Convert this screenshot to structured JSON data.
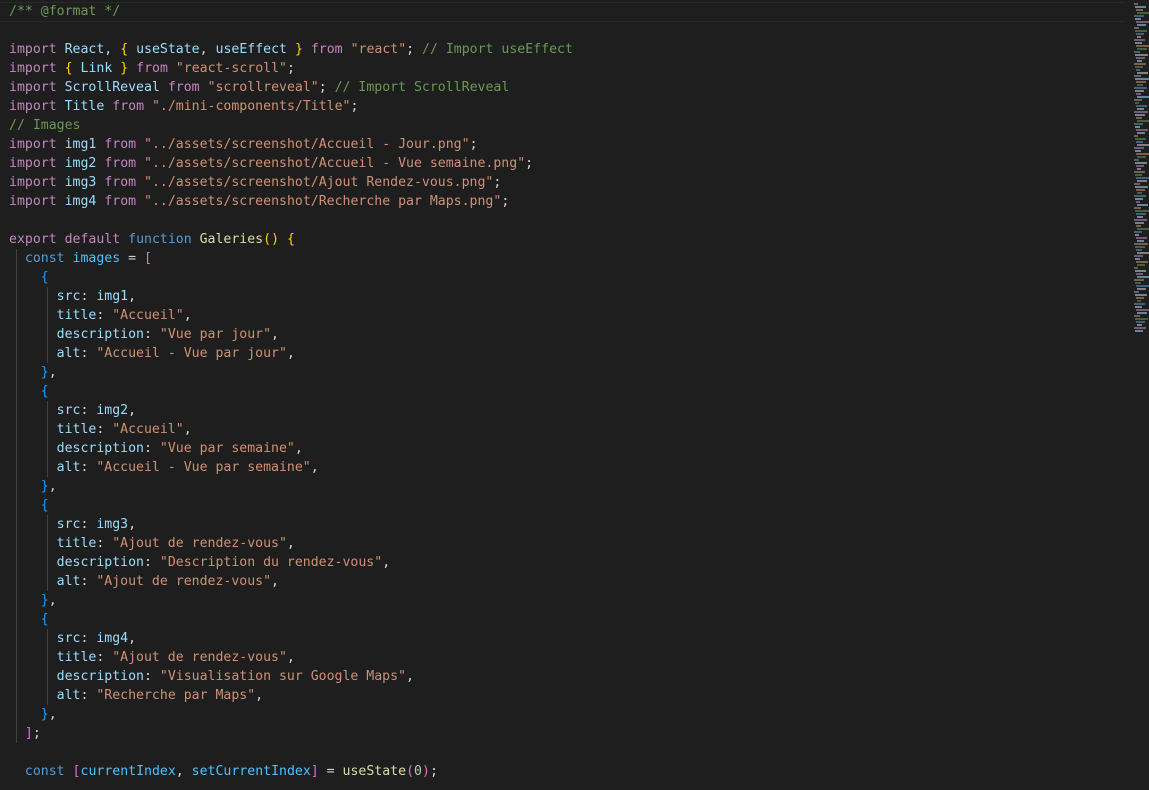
{
  "editor": {
    "language": "javascript",
    "lines": [
      [
        [
          "cm",
          "/** @format */"
        ]
      ],
      [],
      [
        [
          "kw",
          "import"
        ],
        [
          "p",
          " "
        ],
        [
          "vr",
          "React"
        ],
        [
          "p",
          ", "
        ],
        [
          "b1",
          "{"
        ],
        [
          "p",
          " "
        ],
        [
          "vr",
          "useState"
        ],
        [
          "p",
          ", "
        ],
        [
          "vr",
          "useEffect"
        ],
        [
          "p",
          " "
        ],
        [
          "b1",
          "}"
        ],
        [
          "p",
          " "
        ],
        [
          "kw",
          "from"
        ],
        [
          "p",
          " "
        ],
        [
          "st",
          "\"react\""
        ],
        [
          "p",
          "; "
        ],
        [
          "cm",
          "// Import useEffect"
        ]
      ],
      [
        [
          "kw",
          "import"
        ],
        [
          "p",
          " "
        ],
        [
          "b1",
          "{"
        ],
        [
          "p",
          " "
        ],
        [
          "vr",
          "Link"
        ],
        [
          "p",
          " "
        ],
        [
          "b1",
          "}"
        ],
        [
          "p",
          " "
        ],
        [
          "kw",
          "from"
        ],
        [
          "p",
          " "
        ],
        [
          "st",
          "\"react-scroll\""
        ],
        [
          "p",
          ";"
        ]
      ],
      [
        [
          "kw",
          "import"
        ],
        [
          "p",
          " "
        ],
        [
          "vr",
          "ScrollReveal"
        ],
        [
          "p",
          " "
        ],
        [
          "kw",
          "from"
        ],
        [
          "p",
          " "
        ],
        [
          "st",
          "\"scrollreveal\""
        ],
        [
          "p",
          "; "
        ],
        [
          "cm",
          "// Import ScrollReveal"
        ]
      ],
      [
        [
          "kw",
          "import"
        ],
        [
          "p",
          " "
        ],
        [
          "vr",
          "Title"
        ],
        [
          "p",
          " "
        ],
        [
          "kw",
          "from"
        ],
        [
          "p",
          " "
        ],
        [
          "st",
          "\"./mini-components/Title\""
        ],
        [
          "p",
          ";"
        ]
      ],
      [
        [
          "cm",
          "// Images"
        ]
      ],
      [
        [
          "kw",
          "import"
        ],
        [
          "p",
          " "
        ],
        [
          "vr",
          "img1"
        ],
        [
          "p",
          " "
        ],
        [
          "kw",
          "from"
        ],
        [
          "p",
          " "
        ],
        [
          "st",
          "\"../assets/screenshot/Accueil - Jour.png\""
        ],
        [
          "p",
          ";"
        ]
      ],
      [
        [
          "kw",
          "import"
        ],
        [
          "p",
          " "
        ],
        [
          "vr",
          "img2"
        ],
        [
          "p",
          " "
        ],
        [
          "kw",
          "from"
        ],
        [
          "p",
          " "
        ],
        [
          "st",
          "\"../assets/screenshot/Accueil - Vue semaine.png\""
        ],
        [
          "p",
          ";"
        ]
      ],
      [
        [
          "kw",
          "import"
        ],
        [
          "p",
          " "
        ],
        [
          "vr",
          "img3"
        ],
        [
          "p",
          " "
        ],
        [
          "kw",
          "from"
        ],
        [
          "p",
          " "
        ],
        [
          "st",
          "\"../assets/screenshot/Ajout Rendez-vous.png\""
        ],
        [
          "p",
          ";"
        ]
      ],
      [
        [
          "kw",
          "import"
        ],
        [
          "p",
          " "
        ],
        [
          "vr",
          "img4"
        ],
        [
          "p",
          " "
        ],
        [
          "kw",
          "from"
        ],
        [
          "p",
          " "
        ],
        [
          "st",
          "\"../assets/screenshot/Recherche par Maps.png\""
        ],
        [
          "p",
          ";"
        ]
      ],
      [],
      [
        [
          "kw",
          "export"
        ],
        [
          "p",
          " "
        ],
        [
          "kw",
          "default"
        ],
        [
          "p",
          " "
        ],
        [
          "sk",
          "function"
        ],
        [
          "p",
          " "
        ],
        [
          "fn",
          "Galeries"
        ],
        [
          "b1",
          "()"
        ],
        [
          "p",
          " "
        ],
        [
          "b1",
          "{"
        ]
      ],
      [
        [
          "p",
          "  "
        ],
        [
          "sk",
          "const"
        ],
        [
          "p",
          " "
        ],
        [
          "cn",
          "images"
        ],
        [
          "p",
          " = "
        ],
        [
          "b2",
          "["
        ]
      ],
      [
        [
          "p",
          "    "
        ],
        [
          "b3",
          "{"
        ]
      ],
      [
        [
          "p",
          "      "
        ],
        [
          "vr",
          "src"
        ],
        [
          "p",
          ": "
        ],
        [
          "vr",
          "img1"
        ],
        [
          "p",
          ","
        ]
      ],
      [
        [
          "p",
          "      "
        ],
        [
          "vr",
          "title"
        ],
        [
          "p",
          ": "
        ],
        [
          "st",
          "\"Accueil\""
        ],
        [
          "p",
          ","
        ]
      ],
      [
        [
          "p",
          "      "
        ],
        [
          "vr",
          "description"
        ],
        [
          "p",
          ": "
        ],
        [
          "st",
          "\"Vue par jour\""
        ],
        [
          "p",
          ","
        ]
      ],
      [
        [
          "p",
          "      "
        ],
        [
          "vr",
          "alt"
        ],
        [
          "p",
          ": "
        ],
        [
          "st",
          "\"Accueil - Vue par jour\""
        ],
        [
          "p",
          ","
        ]
      ],
      [
        [
          "p",
          "    "
        ],
        [
          "b3",
          "}"
        ],
        [
          "p",
          ","
        ]
      ],
      [
        [
          "p",
          "    "
        ],
        [
          "b3",
          "{"
        ]
      ],
      [
        [
          "p",
          "      "
        ],
        [
          "vr",
          "src"
        ],
        [
          "p",
          ": "
        ],
        [
          "vr",
          "img2"
        ],
        [
          "p",
          ","
        ]
      ],
      [
        [
          "p",
          "      "
        ],
        [
          "vr",
          "title"
        ],
        [
          "p",
          ": "
        ],
        [
          "st",
          "\"Accueil\""
        ],
        [
          "p",
          ","
        ]
      ],
      [
        [
          "p",
          "      "
        ],
        [
          "vr",
          "description"
        ],
        [
          "p",
          ": "
        ],
        [
          "st",
          "\"Vue par semaine\""
        ],
        [
          "p",
          ","
        ]
      ],
      [
        [
          "p",
          "      "
        ],
        [
          "vr",
          "alt"
        ],
        [
          "p",
          ": "
        ],
        [
          "st",
          "\"Accueil - Vue par semaine\""
        ],
        [
          "p",
          ","
        ]
      ],
      [
        [
          "p",
          "    "
        ],
        [
          "b3",
          "}"
        ],
        [
          "p",
          ","
        ]
      ],
      [
        [
          "p",
          "    "
        ],
        [
          "b3",
          "{"
        ]
      ],
      [
        [
          "p",
          "      "
        ],
        [
          "vr",
          "src"
        ],
        [
          "p",
          ": "
        ],
        [
          "vr",
          "img3"
        ],
        [
          "p",
          ","
        ]
      ],
      [
        [
          "p",
          "      "
        ],
        [
          "vr",
          "title"
        ],
        [
          "p",
          ": "
        ],
        [
          "st",
          "\"Ajout de rendez-vous\""
        ],
        [
          "p",
          ","
        ]
      ],
      [
        [
          "p",
          "      "
        ],
        [
          "vr",
          "description"
        ],
        [
          "p",
          ": "
        ],
        [
          "st",
          "\"Description du rendez-vous\""
        ],
        [
          "p",
          ","
        ]
      ],
      [
        [
          "p",
          "      "
        ],
        [
          "vr",
          "alt"
        ],
        [
          "p",
          ": "
        ],
        [
          "st",
          "\"Ajout de rendez-vous\""
        ],
        [
          "p",
          ","
        ]
      ],
      [
        [
          "p",
          "    "
        ],
        [
          "b3",
          "}"
        ],
        [
          "p",
          ","
        ]
      ],
      [
        [
          "p",
          "    "
        ],
        [
          "b3",
          "{"
        ]
      ],
      [
        [
          "p",
          "      "
        ],
        [
          "vr",
          "src"
        ],
        [
          "p",
          ": "
        ],
        [
          "vr",
          "img4"
        ],
        [
          "p",
          ","
        ]
      ],
      [
        [
          "p",
          "      "
        ],
        [
          "vr",
          "title"
        ],
        [
          "p",
          ": "
        ],
        [
          "st",
          "\"Ajout de rendez-vous\""
        ],
        [
          "p",
          ","
        ]
      ],
      [
        [
          "p",
          "      "
        ],
        [
          "vr",
          "description"
        ],
        [
          "p",
          ": "
        ],
        [
          "st",
          "\"Visualisation sur Google Maps\""
        ],
        [
          "p",
          ","
        ]
      ],
      [
        [
          "p",
          "      "
        ],
        [
          "vr",
          "alt"
        ],
        [
          "p",
          ": "
        ],
        [
          "st",
          "\"Recherche par Maps\""
        ],
        [
          "p",
          ","
        ]
      ],
      [
        [
          "p",
          "    "
        ],
        [
          "b3",
          "}"
        ],
        [
          "p",
          ","
        ]
      ],
      [
        [
          "p",
          "  "
        ],
        [
          "b2",
          "]"
        ],
        [
          "p",
          ";"
        ]
      ],
      [],
      [
        [
          "p",
          "  "
        ],
        [
          "sk",
          "const"
        ],
        [
          "p",
          " "
        ],
        [
          "b2",
          "["
        ],
        [
          "cn",
          "currentIndex"
        ],
        [
          "p",
          ", "
        ],
        [
          "cn",
          "setCurrentIndex"
        ],
        [
          "b2",
          "]"
        ],
        [
          "p",
          " = "
        ],
        [
          "fn",
          "useState"
        ],
        [
          "b2",
          "("
        ],
        [
          "nm",
          "0"
        ],
        [
          "b2",
          ")"
        ],
        [
          "p",
          ";"
        ]
      ]
    ]
  },
  "colors": {
    "background": "#1e1e1e",
    "comment": "#6a9955",
    "keyword": "#c586c0",
    "string": "#ce9178",
    "variable": "#9cdcfe",
    "function": "#dcdcaa",
    "storage": "#569cd6"
  }
}
